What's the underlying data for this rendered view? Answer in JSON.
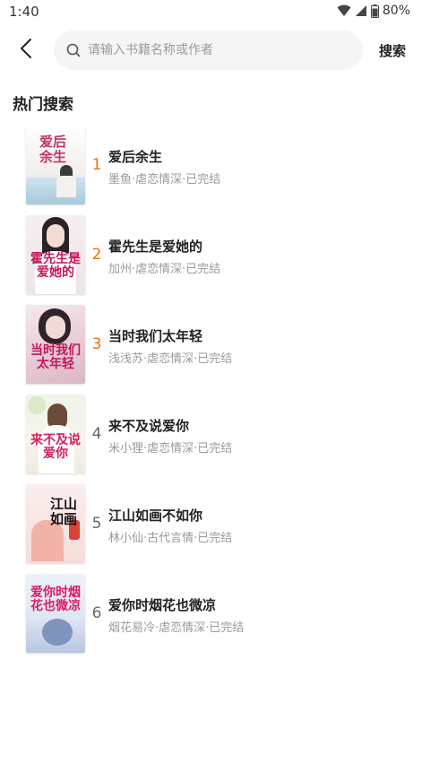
{
  "status_bar": {
    "time": "1:40",
    "battery": "80%",
    "icons": [
      "wifi-icon",
      "signal-icon",
      "battery-icon"
    ]
  },
  "search": {
    "placeholder": "请输入书籍名称或作者",
    "value": "",
    "button_label": "搜索"
  },
  "section": {
    "title": "热门搜索"
  },
  "colors": {
    "accent": "#ff6a00",
    "muted": "#9a9a9a",
    "search_bg": "#f5f5f5"
  },
  "books": [
    {
      "rank": "1",
      "title": "爱后余生",
      "meta": "墨鱼·虐恋情深·已完结",
      "cover_text": "爱后余生"
    },
    {
      "rank": "2",
      "title": "霍先生是爱她的",
      "meta": "加州·虐恋情深·已完结",
      "cover_text": "霍先生是爱她的"
    },
    {
      "rank": "3",
      "title": "当时我们太年轻",
      "meta": "浅浅苏·虐恋情深·已完结",
      "cover_text": "当时我们太年轻"
    },
    {
      "rank": "4",
      "title": "来不及说爱你",
      "meta": "米小狸·虐恋情深·已完结",
      "cover_text": "来不及说爱你"
    },
    {
      "rank": "5",
      "title": "江山如画不如你",
      "meta": "林小仙·古代言情·已完结",
      "cover_text": "江山如画"
    },
    {
      "rank": "6",
      "title": "爱你时烟花也微凉",
      "meta": "烟花易冷·虐恋情深·已完结",
      "cover_text": "爱你时烟花也微凉"
    }
  ]
}
